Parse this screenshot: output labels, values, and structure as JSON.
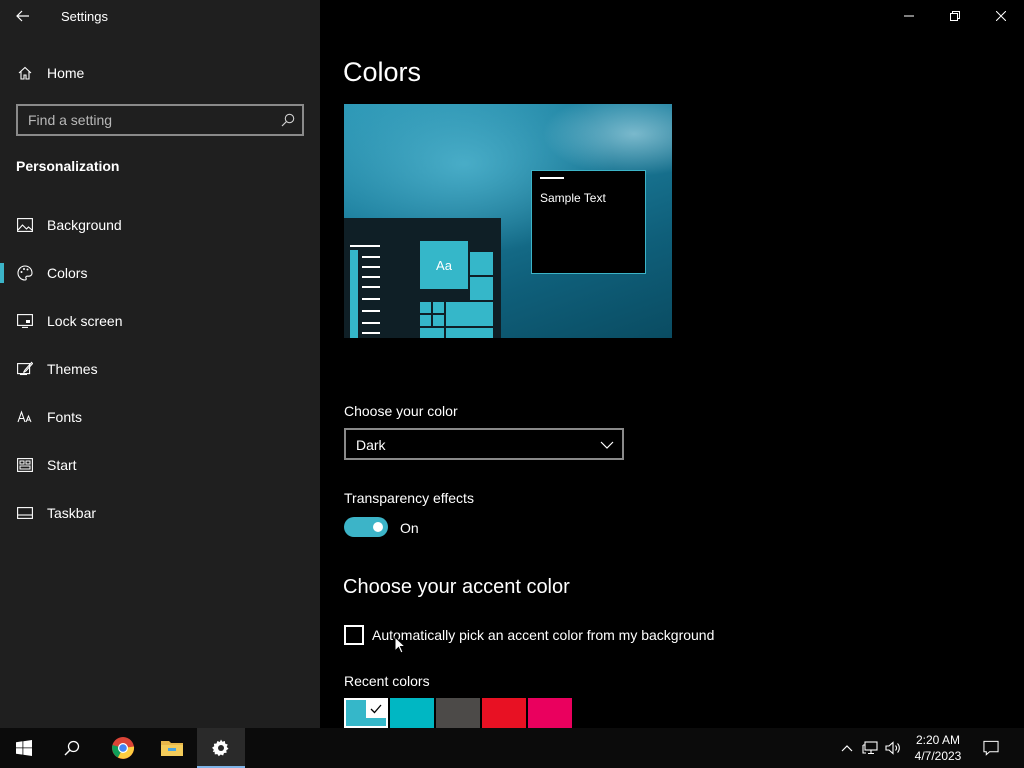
{
  "window": {
    "title": "Settings"
  },
  "sidebar": {
    "home_label": "Home",
    "search": {
      "placeholder": "Find a setting",
      "value": ""
    },
    "section_title": "Personalization",
    "items": [
      {
        "label": "Background",
        "icon": "image-icon",
        "selected": false
      },
      {
        "label": "Colors",
        "icon": "palette-icon",
        "selected": true
      },
      {
        "label": "Lock screen",
        "icon": "lock-screen-icon",
        "selected": false
      },
      {
        "label": "Themes",
        "icon": "brush-icon",
        "selected": false
      },
      {
        "label": "Fonts",
        "icon": "fonts-icon",
        "selected": false
      },
      {
        "label": "Start",
        "icon": "start-icon",
        "selected": false
      },
      {
        "label": "Taskbar",
        "icon": "taskbar-icon",
        "selected": false
      }
    ]
  },
  "main": {
    "title": "Colors",
    "preview": {
      "sample_text": "Sample Text",
      "tile_text": "Aa"
    },
    "choose_color": {
      "label": "Choose your color",
      "selected": "Dark"
    },
    "transparency": {
      "label": "Transparency effects",
      "state": "On",
      "enabled": true
    },
    "accent": {
      "heading": "Choose your accent color",
      "auto_pick_label": "Automatically pick an accent color from my background",
      "auto_pick_checked": false,
      "recent_label": "Recent colors",
      "recent_colors": [
        "#35b7c9",
        "#00b7c3",
        "#4c4a48",
        "#e81123",
        "#ea005e"
      ],
      "selected_index": 0
    }
  },
  "colors": {
    "accent": "#3cb4c8",
    "sidebar_bg": "#1f1f1f",
    "main_bg": "#000000"
  },
  "taskbar": {
    "apps": [
      "windows-start-icon",
      "search-icon",
      "chrome-icon",
      "file-explorer-icon",
      "settings-gear-icon"
    ],
    "active_app": "settings-gear-icon",
    "time": "2:20 AM",
    "date": "4/7/2023"
  }
}
